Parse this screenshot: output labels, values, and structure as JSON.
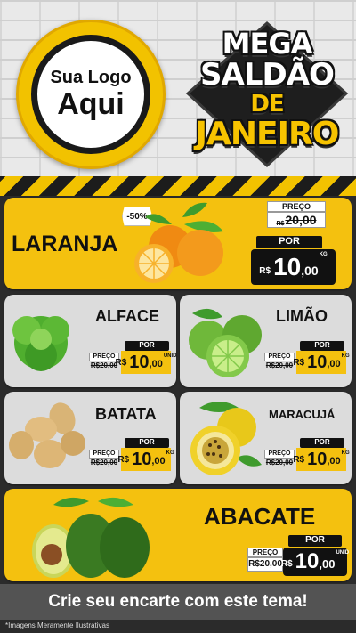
{
  "logo": {
    "line1": "Sua Logo",
    "line2": "Aqui"
  },
  "headline": {
    "l1": "MEGA",
    "l2": "SALDÃO",
    "l3": "DE",
    "l4": "JANEIRO"
  },
  "featured": {
    "name": "LARANJA",
    "discount": "-50%",
    "preco_label": "PREÇO",
    "currency_old": "R$",
    "old_price": "20,00",
    "por_label": "POR",
    "currency": "R$",
    "price_int": "10",
    "price_cents": ",00",
    "unit": "KG"
  },
  "products": [
    {
      "name": "ALFACE",
      "preco_label": "PREÇO",
      "old_price": "R$20,00",
      "por_label": "POR",
      "currency": "R$",
      "price_int": "10",
      "price_cents": ",00",
      "unit": "UNID"
    },
    {
      "name": "LIMÃO",
      "preco_label": "PREÇO",
      "old_price": "R$20,00",
      "por_label": "POR",
      "currency": "R$",
      "price_int": "10",
      "price_cents": ",00",
      "unit": "KG"
    },
    {
      "name": "BATATA",
      "preco_label": "PREÇO",
      "old_price": "R$20,00",
      "por_label": "POR",
      "currency": "R$",
      "price_int": "10",
      "price_cents": ",00",
      "unit": "KG"
    },
    {
      "name": "MARACUJÁ",
      "preco_label": "PREÇO",
      "old_price": "R$20,00",
      "por_label": "POR",
      "currency": "R$",
      "price_int": "10",
      "price_cents": ",00",
      "unit": "KG"
    }
  ],
  "bottom": {
    "name": "ABACATE",
    "preco_label": "PREÇO",
    "old_price": "R$20,00",
    "por_label": "POR",
    "currency": "R$",
    "price_int": "10",
    "price_cents": ",00",
    "unit": "UNID"
  },
  "cta": "Crie seu encarte com este tema!",
  "footnote": "*Imagens Meramente Ilustrativas",
  "colors": {
    "accent": "#f4c10f",
    "dark": "#111111",
    "panel_gray": "#dcdcdc"
  }
}
